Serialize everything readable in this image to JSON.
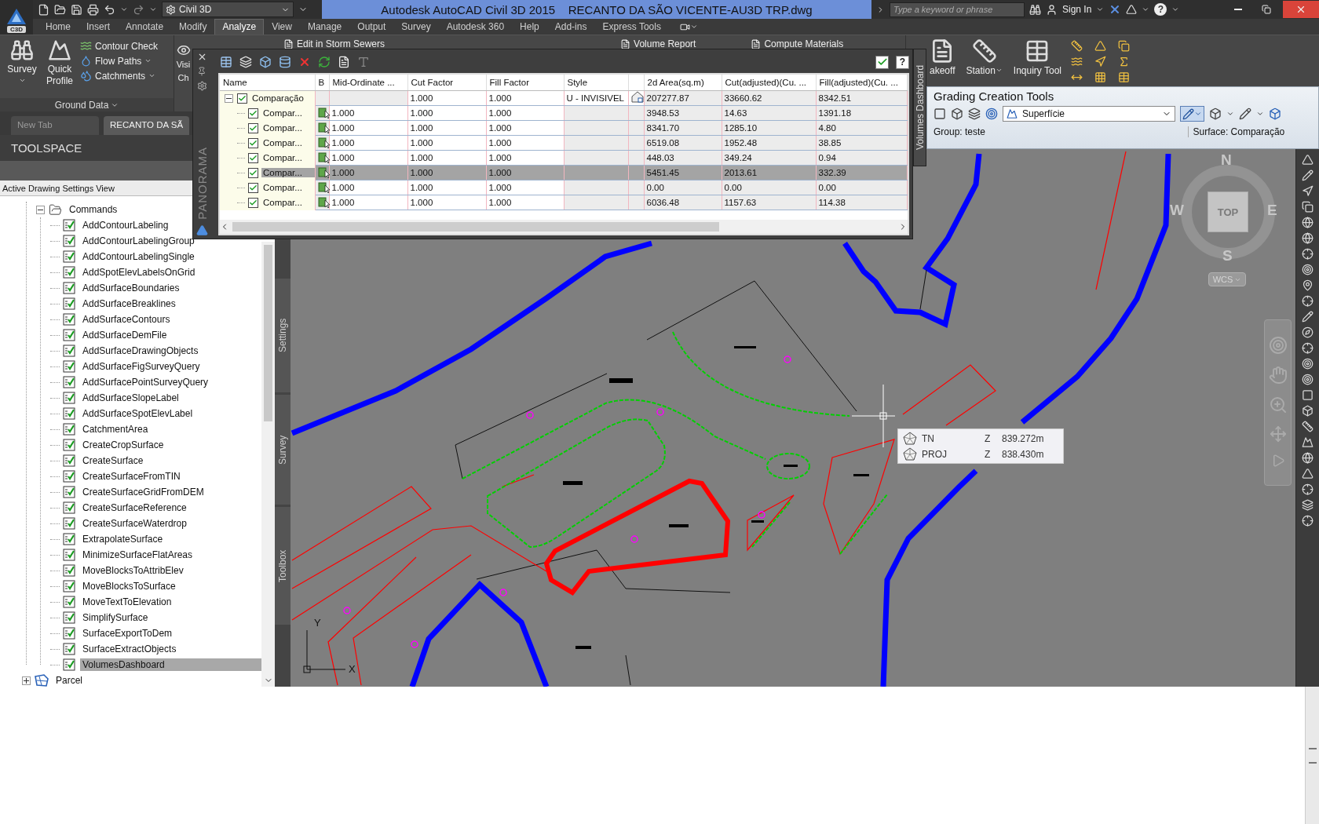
{
  "app_button": {
    "label": "C3D"
  },
  "workspace": {
    "label": "Civil 3D"
  },
  "window": {
    "title": "Autodesk AutoCAD Civil 3D 2015    RECANTO DA SÃO VICENTE-AU3D TRP.dwg"
  },
  "search": {
    "placeholder": "Type a keyword or phrase"
  },
  "account": {
    "label": "Sign In"
  },
  "help_button": {
    "label": "?"
  },
  "ribbon_tabs": [
    {
      "label": "Home",
      "selected": false
    },
    {
      "label": "Insert",
      "selected": false
    },
    {
      "label": "Annotate",
      "selected": false
    },
    {
      "label": "Modify",
      "selected": false
    },
    {
      "label": "Analyze",
      "selected": true
    },
    {
      "label": "View",
      "selected": false
    },
    {
      "label": "Manage",
      "selected": false
    },
    {
      "label": "Output",
      "selected": false
    },
    {
      "label": "Survey",
      "selected": false
    },
    {
      "label": "Autodesk 360",
      "selected": false
    },
    {
      "label": "Help",
      "selected": false
    },
    {
      "label": "Add-ins",
      "selected": false
    },
    {
      "label": "Express Tools",
      "selected": false
    }
  ],
  "ground_data": {
    "title": "Ground Data",
    "large_buttons": [
      {
        "label": "Survey",
        "dropdown": true
      },
      {
        "label": "Quick Profile",
        "dropdown": false
      }
    ],
    "small_buttons": [
      {
        "label": "Contour Check",
        "dropdown": false
      },
      {
        "label": "Flow Paths",
        "dropdown": true
      },
      {
        "label": "Catchments",
        "dropdown": true
      }
    ]
  },
  "visibility_button": {
    "lines": [
      "Visi",
      "Ch"
    ]
  },
  "analysis_buttons": [
    {
      "label": "Edit in Storm Sewers"
    },
    {
      "label": "Volume Report"
    },
    {
      "label": "Compute Materials"
    }
  ],
  "takeoff_button": {
    "label": "akeoff"
  },
  "inquiry_buttons": [
    {
      "label": "Station",
      "dropdown": true
    },
    {
      "label": "Inquiry Tool",
      "dropdown": false
    }
  ],
  "document_tabs": [
    {
      "label": "New Tab",
      "selected": false
    },
    {
      "label": "RECANTO DA SÃ",
      "selected": true
    }
  ],
  "toolspace": {
    "title": "TOOLSPACE",
    "view": "Active Drawing Settings View",
    "tree": [
      {
        "kind": "branch",
        "children": [
          {
            "kind": "folder",
            "label": "Commands",
            "expanded": true,
            "selected": false,
            "children": [
              {
                "kind": "command",
                "label": "AddContourLabeling",
                "selected": false
              },
              {
                "kind": "command",
                "label": "AddContourLabelingGroup",
                "selected": false
              },
              {
                "kind": "command",
                "label": "AddContourLabelingSingle",
                "selected": false
              },
              {
                "kind": "command",
                "label": "AddSpotElevLabelsOnGrid",
                "selected": false
              },
              {
                "kind": "command",
                "label": "AddSurfaceBoundaries",
                "selected": false
              },
              {
                "kind": "command",
                "label": "AddSurfaceBreaklines",
                "selected": false
              },
              {
                "kind": "command",
                "label": "AddSurfaceContours",
                "selected": false
              },
              {
                "kind": "command",
                "label": "AddSurfaceDemFile",
                "selected": false
              },
              {
                "kind": "command",
                "label": "AddSurfaceDrawingObjects",
                "selected": false
              },
              {
                "kind": "command",
                "label": "AddSurfaceFigSurveyQuery",
                "selected": false
              },
              {
                "kind": "command",
                "label": "AddSurfacePointSurveyQuery",
                "selected": false
              },
              {
                "kind": "command",
                "label": "AddSurfaceSlopeLabel",
                "selected": false
              },
              {
                "kind": "command",
                "label": "AddSurfaceSpotElevLabel",
                "selected": false
              },
              {
                "kind": "command",
                "label": "CatchmentArea",
                "selected": false
              },
              {
                "kind": "command",
                "label": "CreateCropSurface",
                "selected": false
              },
              {
                "kind": "command",
                "label": "CreateSurface",
                "selected": false
              },
              {
                "kind": "command",
                "label": "CreateSurfaceFromTIN",
                "selected": false
              },
              {
                "kind": "command",
                "label": "CreateSurfaceGridFromDEM",
                "selected": false
              },
              {
                "kind": "command",
                "label": "CreateSurfaceReference",
                "selected": false
              },
              {
                "kind": "command",
                "label": "CreateSurfaceWaterdrop",
                "selected": false
              },
              {
                "kind": "command",
                "label": "ExtrapolateSurface",
                "selected": false
              },
              {
                "kind": "command",
                "label": "MinimizeSurfaceFlatAreas",
                "selected": false
              },
              {
                "kind": "command",
                "label": "MoveBlocksToAttribElev",
                "selected": false
              },
              {
                "kind": "command",
                "label": "MoveBlocksToSurface",
                "selected": false
              },
              {
                "kind": "command",
                "label": "MoveTextToElevation",
                "selected": false
              },
              {
                "kind": "command",
                "label": "SimplifySurface",
                "selected": false
              },
              {
                "kind": "command",
                "label": "SurfaceExportToDem",
                "selected": false
              },
              {
                "kind": "command",
                "label": "SurfaceExtractObjects",
                "selected": false
              },
              {
                "kind": "command",
                "label": "VolumesDashboard",
                "selected": true
              }
            ]
          }
        ]
      },
      {
        "kind": "parcel",
        "label": "Parcel",
        "expanded": false,
        "selected": false
      }
    ]
  },
  "side_tabs": [
    {
      "label": "Settings"
    },
    {
      "label": "Survey"
    },
    {
      "label": "Toolbox"
    }
  ],
  "panorama": {
    "title": "PANORAMA",
    "dashboard_tab": "Volumes Dashboard",
    "help": "?",
    "columns": [
      "Name",
      "B",
      "Mid-Ordinate ...",
      "Cut Factor",
      "Fill Factor",
      "Style",
      "2d Area(sq.m)",
      "Cut(adjusted)(Cu. ...",
      "Fill(adjusted)(Cu. ..."
    ],
    "root": {
      "name": "Comparação",
      "checked": true,
      "expanded": true,
      "selected": false,
      "cut_factor": "1.000",
      "fill_factor": "1.000",
      "style": "U - INVISIVEL",
      "area": "207277.87",
      "cut": "33660.62",
      "fill": "8342.51",
      "children": [
        {
          "name": "Compar...",
          "checked": true,
          "selected": false,
          "mid_ordinate": "1.000",
          "cut_factor": "1.000",
          "fill_factor": "1.000",
          "area": "3948.53",
          "cut": "14.63",
          "fill": "1391.18"
        },
        {
          "name": "Compar...",
          "checked": true,
          "selected": false,
          "mid_ordinate": "1.000",
          "cut_factor": "1.000",
          "fill_factor": "1.000",
          "area": "8341.70",
          "cut": "1285.10",
          "fill": "4.80"
        },
        {
          "name": "Compar...",
          "checked": true,
          "selected": false,
          "mid_ordinate": "1.000",
          "cut_factor": "1.000",
          "fill_factor": "1.000",
          "area": "6519.08",
          "cut": "1952.48",
          "fill": "38.85"
        },
        {
          "name": "Compar...",
          "checked": true,
          "selected": false,
          "mid_ordinate": "1.000",
          "cut_factor": "1.000",
          "fill_factor": "1.000",
          "area": "448.03",
          "cut": "349.24",
          "fill": "0.94"
        },
        {
          "name": "Compar...",
          "checked": true,
          "selected": true,
          "mid_ordinate": "1.000",
          "cut_factor": "1.000",
          "fill_factor": "1.000",
          "area": "5451.45",
          "cut": "2013.61",
          "fill": "332.39"
        },
        {
          "name": "Compar...",
          "checked": true,
          "selected": false,
          "mid_ordinate": "1.000",
          "cut_factor": "1.000",
          "fill_factor": "1.000",
          "area": "0.00",
          "cut": "0.00",
          "fill": "0.00"
        },
        {
          "name": "Compar...",
          "checked": true,
          "selected": false,
          "mid_ordinate": "1.000",
          "cut_factor": "1.000",
          "fill_factor": "1.000",
          "area": "6036.48",
          "cut": "1157.63",
          "fill": "114.38"
        }
      ]
    }
  },
  "grading_tools": {
    "title": "Grading Creation Tools",
    "surface": "Superfície",
    "group": "Group: teste",
    "surface_status": "Surface: Comparação"
  },
  "viewcube": {
    "face": "TOP",
    "north": "N",
    "south": "S",
    "east": "E",
    "west": "W",
    "ucs": "WCS"
  },
  "ucs_icon": {
    "x": "X",
    "y": "Y"
  },
  "tooltip": {
    "rows": [
      {
        "name": "TN",
        "axis": "Z",
        "value": "839.272m"
      },
      {
        "name": "PROJ",
        "axis": "Z",
        "value": "838.430m"
      }
    ]
  }
}
